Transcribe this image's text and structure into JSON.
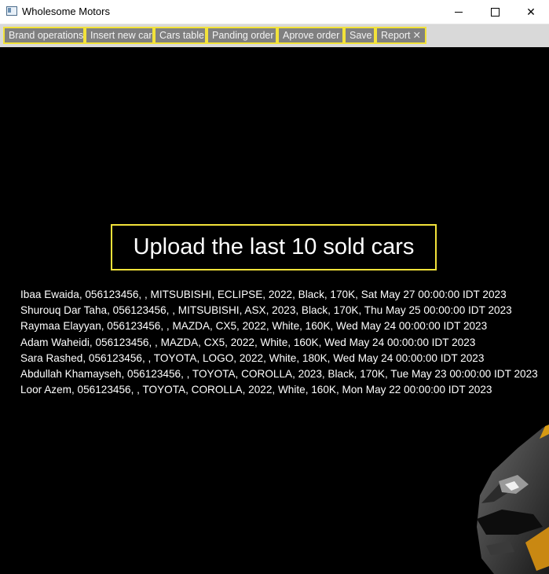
{
  "window": {
    "title": "Wholesome Motors",
    "minimize_label": "minimize",
    "maximize_label": "maximize",
    "close_label": "close"
  },
  "tabs": [
    {
      "label": "Brand operations"
    },
    {
      "label": "Insert new car"
    },
    {
      "label": "Cars table"
    },
    {
      "label": "Panding order"
    },
    {
      "label": "Aprove order"
    },
    {
      "label": "Save"
    },
    {
      "label": "Report",
      "closable": true
    }
  ],
  "main": {
    "upload_button_label": "Upload the last 10 sold cars",
    "sold_cars": [
      "Ibaa Ewaida, 056123456, , MITSUBISHI, ECLIPSE, 2022, Black, 170K, Sat May 27 00:00:00 IDT 2023",
      "Shurouq Dar Taha, 056123456, , MITSUBISHI, ASX, 2023, Black, 170K, Thu May 25 00:00:00 IDT 2023",
      "Raymaa Elayyan, 056123456, , MAZDA, CX5, 2022, White, 160K, Wed May 24 00:00:00 IDT 2023",
      "Adam Waheidi, 056123456, , MAZDA, CX5, 2022, White, 160K, Wed May 24 00:00:00 IDT 2023",
      "Sara Rashed, 056123456, , TOYOTA, LOGO, 2022, White, 180K, Wed May 24 00:00:00 IDT 2023",
      "Abdullah Khamayseh, 056123456, , TOYOTA, COROLLA, 2023, Black, 170K, Tue May 23 00:00:00 IDT 2023",
      "Loor Azem, 056123456, , TOYOTA, COROLLA, 2022, White, 160K, Mon May 22 00:00:00 IDT 2023"
    ]
  },
  "colors": {
    "accent_border": "#f2e23a",
    "tab_background": "#808080",
    "content_background": "#000000"
  }
}
